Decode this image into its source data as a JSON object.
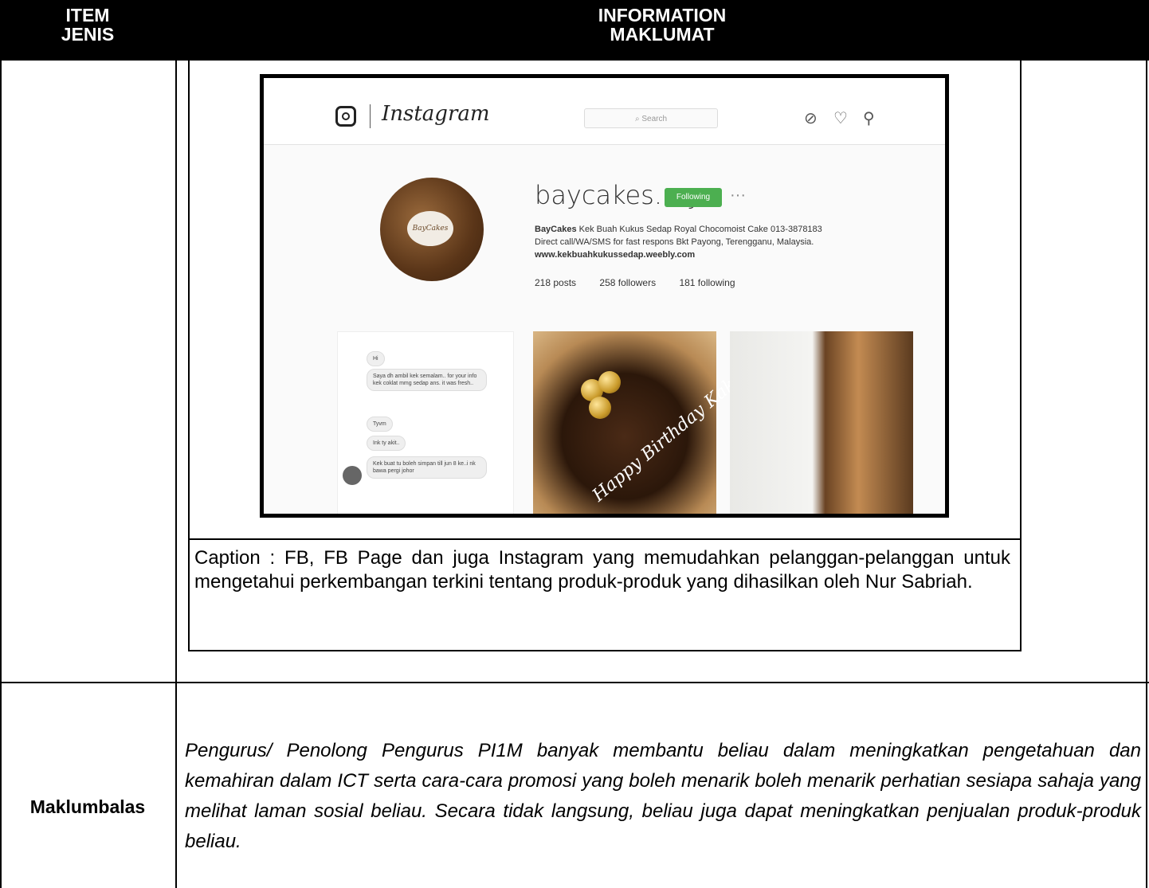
{
  "header": {
    "item_line1": "ITEM",
    "item_line2": "JENIS",
    "info_line1": "INFORMATION",
    "info_line2": "MAKLUMAT"
  },
  "instagram": {
    "wordmark": "Instagram",
    "search_placeholder": "Search",
    "avatar_text": "BayCakes",
    "username": "baycakes.my",
    "follow_label": "Following",
    "more": "···",
    "bio_line1_bold": "BayCakes",
    "bio_line1_rest": " Kek Buah Kukus Sedap  Royal Chocomoist Cake  013-3878183",
    "bio_line2": "Direct call/WA/SMS for fast respons  Bkt Payong, Terengganu, Malaysia.",
    "bio_link": "www.kekbuahkukussedap.weebly.com",
    "posts": "218 posts",
    "followers": "258 followers",
    "following": "181 following",
    "chat": [
      "Hi",
      "Saya dh ambil kek semalam.. for your info kek coklat mmg sedap ans. it was fresh..",
      "Tyvm",
      "Ink ty akit..",
      "Kek buat tu boleh simpan till jun 8 ke..i nk bawa pergi johor"
    ],
    "cake_text": "Happy Birthday Kak La"
  },
  "caption": "Caption : FB, FB Page dan juga Instagram yang memudahkan pelanggan-pelanggan untuk mengetahui perkembangan terkini tentang produk-produk yang dihasilkan oleh Nur Sabriah.",
  "feedback": {
    "label": "Maklumbalas",
    "text": "Pengurus/ Penolong Pengurus PI1M banyak membantu beliau dalam meningkatkan pengetahuan dan kemahiran dalam ICT serta cara-cara promosi yang boleh menarik boleh menarik  perhatian sesiapa sahaja yang melihat laman sosial beliau. Secara tidak langsung, beliau juga dapat meningkatkan penjualan produk-produk beliau."
  }
}
